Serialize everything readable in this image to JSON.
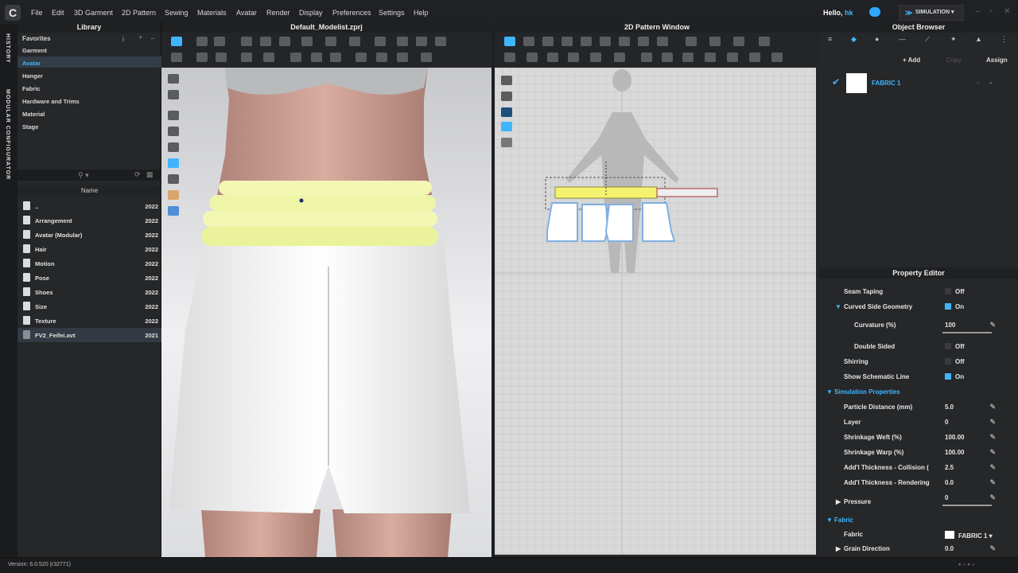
{
  "app": {
    "logo": "C"
  },
  "menu": [
    "File",
    "Edit",
    "3D Garment",
    "2D Pattern",
    "Sewing",
    "Materials",
    "Avatar",
    "Render",
    "Display",
    "Preferences",
    "Settings",
    "Help"
  ],
  "user": {
    "greeting": "Hello,",
    "name": "hk"
  },
  "mode_button": "SIMULATION",
  "side_tabs": [
    "HISTORY",
    "MODULAR CONFIGURATOR"
  ],
  "library": {
    "title": "Library",
    "favorites_label": "Favorites",
    "favorites": [
      "Garment",
      "Avatar",
      "Hanger",
      "Fabric",
      "Hardware and Trims",
      "Material",
      "Stage"
    ],
    "column_name": "Name",
    "files": [
      {
        "name": "..",
        "year": "2022"
      },
      {
        "name": "Arrangement",
        "year": "2022"
      },
      {
        "name": "Avatar (Modular)",
        "year": "2022"
      },
      {
        "name": "Hair",
        "year": "2022"
      },
      {
        "name": "Motion",
        "year": "2022"
      },
      {
        "name": "Pose",
        "year": "2022"
      },
      {
        "name": "Shoes",
        "year": "2022"
      },
      {
        "name": "Size",
        "year": "2022"
      },
      {
        "name": "Texture",
        "year": "2022"
      },
      {
        "name": "FV2_Feifei.avt",
        "year": "2021"
      }
    ]
  },
  "view3d": {
    "title": "Default_Modelist.zprj"
  },
  "view2d": {
    "title": "2D Pattern Window"
  },
  "object_browser": {
    "title": "Object Browser",
    "add": "+ Add",
    "copy": "Copy",
    "assign": "Assign",
    "fabric_name": "FABRIC 1"
  },
  "property_editor": {
    "title": "Property Editor",
    "rows": [
      {
        "label": "Seam Taping",
        "value": "Off",
        "type": "check",
        "checked": false
      },
      {
        "label": "Curved Side Geometry",
        "value": "On",
        "type": "check",
        "checked": true,
        "arrow": "▼"
      },
      {
        "label": "Curvature (%)",
        "value": "100",
        "type": "slider"
      },
      {
        "label": "Double Sided",
        "value": "Off",
        "type": "check",
        "checked": false
      },
      {
        "label": "Shirring",
        "value": "Off",
        "type": "check",
        "checked": false
      },
      {
        "label": "Show Schematic Line",
        "value": "On",
        "type": "check",
        "checked": true
      }
    ],
    "sim_section": "Simulation Properties",
    "sim_rows": [
      {
        "label": "Particle Distance (mm)",
        "value": "5.0"
      },
      {
        "label": "Layer",
        "value": "0"
      },
      {
        "label": "Shrinkage Weft (%)",
        "value": "100.00"
      },
      {
        "label": "Shrinkage Warp (%)",
        "value": "100.00"
      },
      {
        "label": "Add'l Thickness - Collision (",
        "value": "2.5"
      },
      {
        "label": "Add'l Thickness - Rendering",
        "value": "0.0"
      }
    ],
    "pressure_label": "Pressure",
    "pressure_value": "0",
    "fabric_section": "Fabric",
    "fabric_label": "Fabric",
    "fabric_value": "FABRIC 1",
    "grain_label": "Grain Direction",
    "grain_value": "0.0"
  },
  "status": {
    "version": "Version: 6.0.520 (r32771)"
  }
}
